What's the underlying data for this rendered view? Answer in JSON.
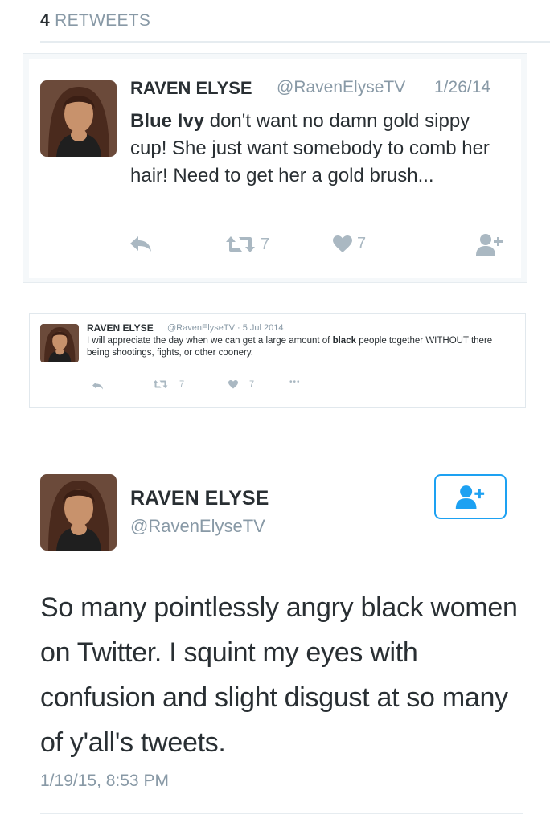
{
  "retweets": {
    "count": "4",
    "label": "RETWEETS"
  },
  "tweets": [
    {
      "name": "RAVEN ELYSE",
      "handle": "@RavenElyseTV",
      "date": "1/26/14",
      "text_bold": "Blue Ivy",
      "text": " don't want no damn gold sippy cup! She just want somebody to comb her hair! Need to get her a gold brush...",
      "retweet_count": "7",
      "like_count": "7"
    },
    {
      "name": "RAVEN ELYSE",
      "handle": "@RavenElyseTV · 5 Jul 2014",
      "text_before": "I will appreciate the day when we can get a large amount of ",
      "text_bold": "black",
      "text_after": " people together WITHOUT there being shootings, fights, or other coonery.",
      "retweet_count": "7",
      "like_count": "7",
      "more": "•••"
    },
    {
      "name": "RAVEN ELYSE",
      "handle": "@RavenElyseTV",
      "text": "So many pointlessly angry black women on Twitter. I squint my eyes with confusion and slight disgust at so many of y'all's tweets.",
      "timestamp": "1/19/15, 8:53 PM"
    }
  ],
  "colors": {
    "accent": "#1da1f2",
    "icon_gray": "#aab8c2",
    "text_gray": "#8899a6",
    "text_dark": "#292f33"
  }
}
